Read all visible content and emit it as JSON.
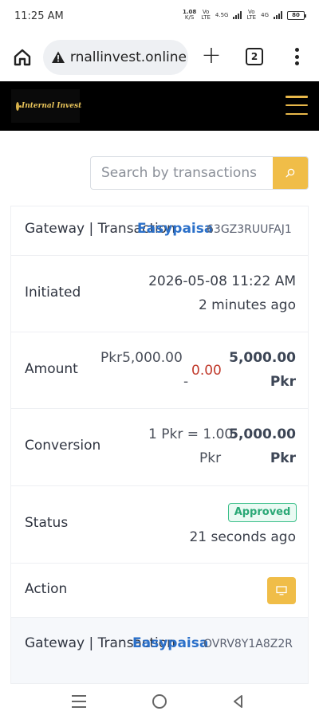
{
  "status_bar": {
    "time": "11:25 AM",
    "net_speed_value": "1.08",
    "net_speed_unit": "K/S",
    "sim1_top": "Vo",
    "sim1_bottom": "LTE",
    "net_type": "4.5G",
    "sim2_top": "Vo",
    "sim2_bottom": "LTE",
    "sim2_net": "4G",
    "battery": "80"
  },
  "browser": {
    "url": "internallinvest.online",
    "tab_count": "2",
    "plus_label": "+"
  },
  "site": {
    "logo_text": "Internal Invest"
  },
  "search": {
    "placeholder": "Search by transactions"
  },
  "rows": {
    "gateway1": {
      "label": "Gateway | Transaction",
      "gateway": "Easypaisa",
      "trx": "63GZ3RUUFAJ1"
    },
    "initiated": {
      "label": "Initiated",
      "datetime": "2026-05-08 11:22 AM",
      "relative": "2 minutes ago"
    },
    "amount": {
      "label": "Amount",
      "base": "Pkr5,000.00",
      "charge": "0.00",
      "minus": "-",
      "total_value": "5,000.00",
      "total_currency": "Pkr"
    },
    "conversion": {
      "label": "Conversion",
      "rate": "1 Pkr = 1.00",
      "rate_currency": "Pkr",
      "final_value": "5,000.00",
      "final_currency": "Pkr"
    },
    "status": {
      "label": "Status",
      "badge": "Approved",
      "relative": "21 seconds ago"
    },
    "action": {
      "label": "Action"
    },
    "gateway2": {
      "label": "Gateway | Transaction",
      "gateway": "Easypaisa",
      "trx": "OVRV8Y1A8Z2R"
    }
  },
  "colors": {
    "accent": "#f0bd48",
    "header_bg": "#000000",
    "gateway_blue": "#2b70c9",
    "approved_green": "#2aa876",
    "charge_red": "#c0392b"
  }
}
